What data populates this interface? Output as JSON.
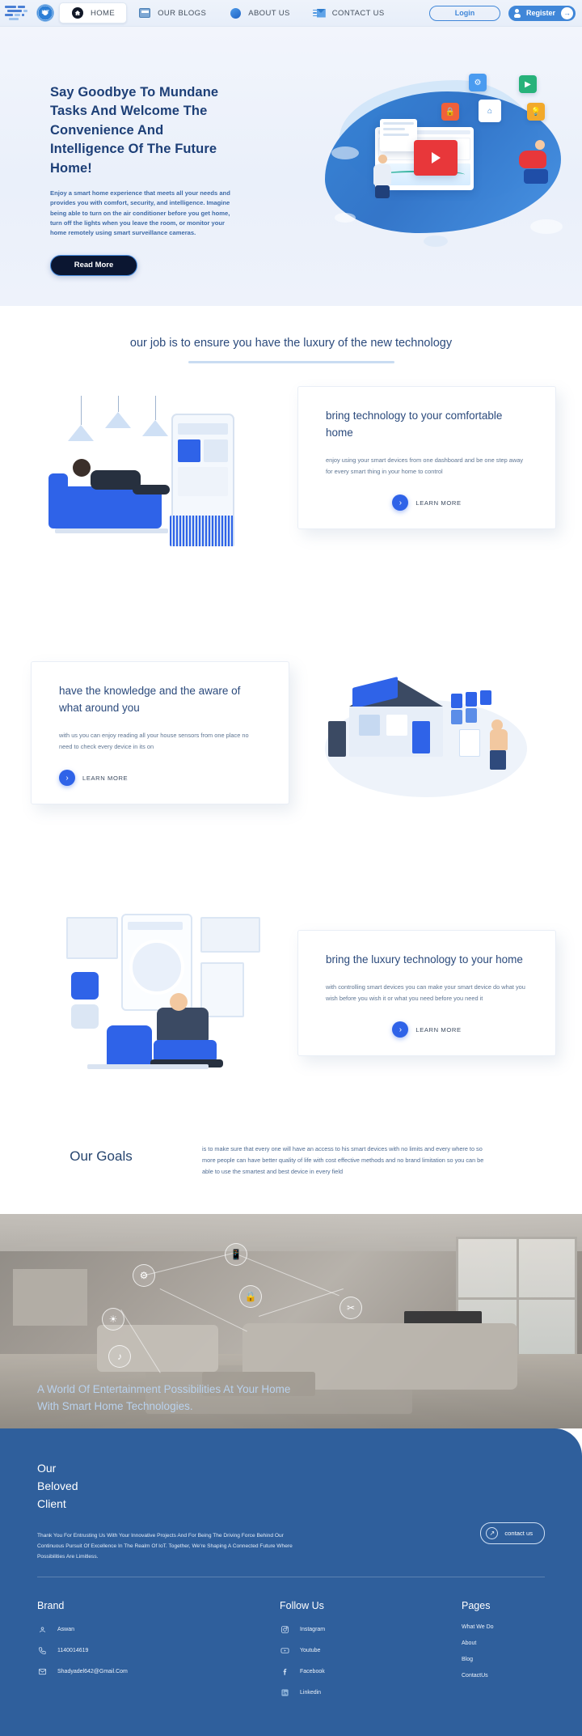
{
  "navbar": {
    "logo_alt": "iot-logo",
    "items": [
      {
        "label": "HOME",
        "icon": "home-icon",
        "active": true
      },
      {
        "label": "OUR BLOGS",
        "icon": "blog-icon",
        "active": false
      },
      {
        "label": "ABOUT US",
        "icon": "about-icon",
        "active": false
      },
      {
        "label": "CONTACT US",
        "icon": "mail-icon",
        "active": false
      }
    ],
    "login_label": "Login",
    "register_label": "Register",
    "register_arrow": "→"
  },
  "hero": {
    "title": "Say Goodbye To Mundane Tasks And Welcome The Convenience And Intelligence Of The Future Home!",
    "paragraph": "Enjoy a smart home experience that meets all your needs and provides you with comfort, security, and intelligence. Imagine being able to turn on the air conditioner before you get home, turn off the lights when you leave the room, or monitor your home remotely using smart surveillance cameras.",
    "cta_label": "Read More"
  },
  "section_heading": {
    "title": "our job is to ensure you have the luxury of the new technology"
  },
  "features": [
    {
      "title": "bring technology to your comfortable home",
      "body": "enjoy using your smart devices from one dashboard and be one step away for every smart thing in your home to control",
      "cta_label": "LEARN MORE",
      "cta_icon": "chevron-right-icon",
      "image_alt": "woman-on-sofa-with-phone-illustration"
    },
    {
      "title": "have the knowledge and the aware of what around you",
      "body": "with us you can enjoy reading all your house sensors from one place no need to check every device in its on",
      "cta_label": "LEARN MORE",
      "cta_icon": "chevron-right-icon",
      "image_alt": "isometric-smart-house-illustration"
    },
    {
      "title": "bring the luxury technology to your home",
      "body": "with controlling smart devices you can make your smart device do what you wish before you wish it or what you need before you need it",
      "cta_label": "LEARN MORE",
      "cta_icon": "chevron-right-icon",
      "image_alt": "man-on-sofa-thermostat-illustration"
    }
  ],
  "goals": {
    "title": "Our Goals",
    "body": "is to make sure that every one will have an access to his smart devices with no limits and every where to so more people can have better quality of life with cost effective methods and no brand limitation so you can be able to use the smartest and best device in every field"
  },
  "banner": {
    "title": "A World Of Entertainment Possibilities At Your Home With Smart Home Technologies.",
    "image_alt": "smart-living-room-with-network-nodes"
  },
  "client": {
    "title": "Our\nBeloved\nClient",
    "title_lines": [
      "Our",
      "Beloved",
      "Client"
    ],
    "body": "Thank You For Entrusting Us With Your Innovative Projects And For Being The Driving Force Behind Our Continuous Pursuit Of Excellence In The Realm Of IoT. Together, We're Shaping A Connected Future Where Possibilities Are Limitless.",
    "cta_label": "contact us",
    "cta_icon": "arrow-right-icon"
  },
  "footer": {
    "brand": {
      "heading": "Brand",
      "rows": [
        {
          "icon": "location-icon",
          "text": "Aswan"
        },
        {
          "icon": "phone-icon",
          "text": "1140014619"
        },
        {
          "icon": "envelope-icon",
          "text": "Shadyadel642@Gmail.Com"
        }
      ]
    },
    "follow": {
      "heading": "Follow Us",
      "rows": [
        {
          "icon": "instagram-icon",
          "text": "Instagram"
        },
        {
          "icon": "youtube-icon",
          "text": "Youtube"
        },
        {
          "icon": "facebook-icon",
          "text": "Facebook"
        },
        {
          "icon": "linkedin-icon",
          "text": "Linkedin"
        }
      ]
    },
    "pages": {
      "heading": "Pages",
      "links": [
        "What We Do",
        "About",
        "Blog",
        "ContactUs"
      ]
    }
  },
  "colors": {
    "primary_blue": "#2f5f9c",
    "accent_blue": "#3f86d8",
    "cta_blue": "#2f63e8",
    "heading_navy": "#2b4a7c",
    "dark_button": "#0b1631"
  }
}
